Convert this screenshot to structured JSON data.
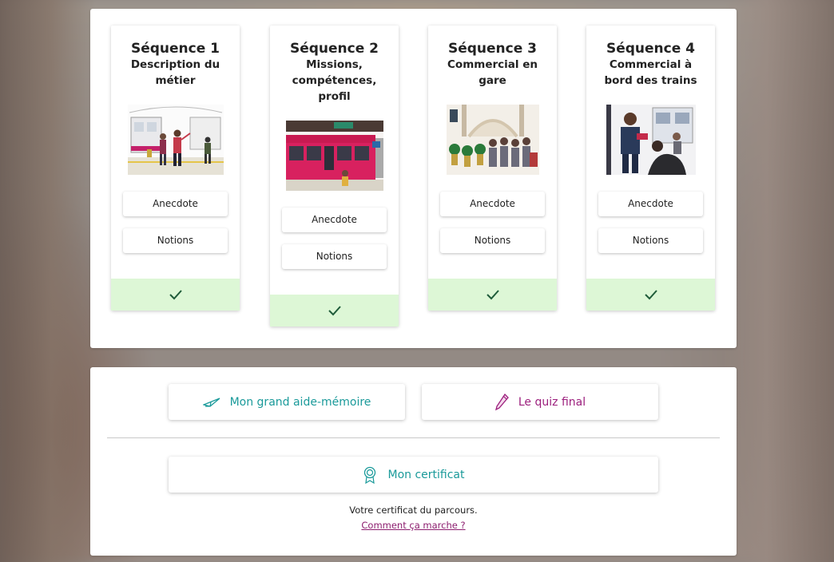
{
  "sequences": [
    {
      "title": "Séquence 1",
      "subtitle": "Description du métier",
      "buttons": [
        "Anecdote",
        "Notions"
      ]
    },
    {
      "title": "Séquence 2",
      "subtitle": "Missions, compétences, profil",
      "buttons": [
        "Anecdote",
        "Notions"
      ]
    },
    {
      "title": "Séquence 3",
      "subtitle": "Commercial en gare",
      "buttons": [
        "Anecdote",
        "Notions"
      ]
    },
    {
      "title": "Séquence 4",
      "subtitle": "Commercial à bord des trains",
      "buttons": [
        "Anecdote",
        "Notions"
      ]
    }
  ],
  "actions": {
    "memo_label": "Mon grand aide-mémoire",
    "quiz_label": "Le quiz final",
    "certificate_label": "Mon certificat"
  },
  "certificate": {
    "description": "Votre certificat du parcours.",
    "help_link": "Comment ça marche ?"
  },
  "colors": {
    "teal": "#1a9a9a",
    "magenta": "#9c1f7d",
    "completed_bg": "#ddf7d6",
    "check": "#1f5c3a"
  },
  "icons": {
    "completed": "check-icon",
    "memo": "paper-plane-icon",
    "quiz": "pencil-icon",
    "certificate": "rosette-icon"
  }
}
